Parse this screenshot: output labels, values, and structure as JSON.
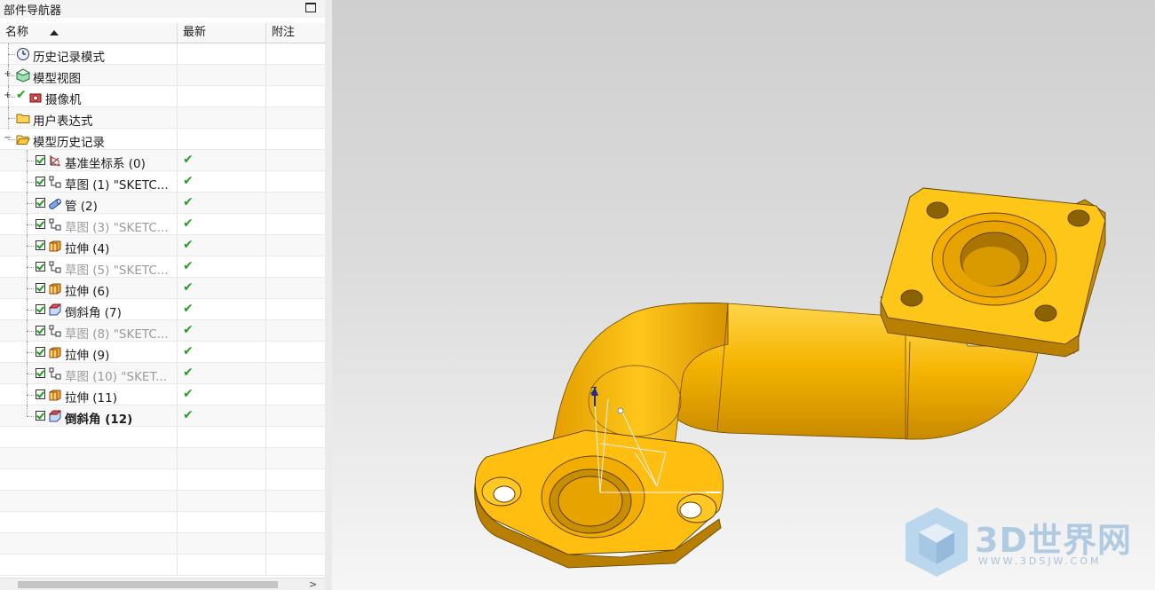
{
  "navigator": {
    "title": "部件导航器",
    "columns": {
      "name": "名称",
      "latest": "最新",
      "notes": "附注"
    },
    "rows": [
      {
        "label": "历史记录模式",
        "icon": "clock-icon",
        "indent": 1,
        "expander": "",
        "checkbox": false,
        "latest": "",
        "style": "normal"
      },
      {
        "label": "模型视图",
        "icon": "model-views-icon",
        "indent": 1,
        "expander": "+",
        "checkbox": false,
        "latest": "",
        "style": "normal"
      },
      {
        "label": "摄像机",
        "icon": "camera-icon",
        "indent": 1,
        "expander": "+",
        "checkbox": false,
        "latest": "",
        "style": "normal"
      },
      {
        "label": "用户表达式",
        "icon": "folder-icon",
        "indent": 1,
        "expander": "",
        "checkbox": false,
        "latest": "",
        "style": "normal"
      },
      {
        "label": "模型历史记录",
        "icon": "folder-open-icon",
        "indent": 1,
        "expander": "−",
        "checkbox": false,
        "latest": "",
        "style": "normal"
      },
      {
        "label": "基准坐标系 (0)",
        "icon": "datum-csys-icon",
        "indent": 2,
        "expander": "",
        "checkbox": true,
        "latest": "✔",
        "style": "normal"
      },
      {
        "label": "草图 (1) \"SKETC...",
        "icon": "sketch-icon",
        "indent": 2,
        "expander": "",
        "checkbox": true,
        "latest": "✔",
        "style": "normal"
      },
      {
        "label": "管 (2)",
        "icon": "tube-icon",
        "indent": 2,
        "expander": "",
        "checkbox": true,
        "latest": "✔",
        "style": "normal"
      },
      {
        "label": "草图 (3) \"SKETC...",
        "icon": "sketch-icon",
        "indent": 2,
        "expander": "",
        "checkbox": true,
        "latest": "✔",
        "style": "gray"
      },
      {
        "label": "拉伸 (4)",
        "icon": "extrude-icon",
        "indent": 2,
        "expander": "",
        "checkbox": true,
        "latest": "✔",
        "style": "normal"
      },
      {
        "label": "草图 (5) \"SKETC...",
        "icon": "sketch-icon",
        "indent": 2,
        "expander": "",
        "checkbox": true,
        "latest": "✔",
        "style": "gray"
      },
      {
        "label": "拉伸 (6)",
        "icon": "extrude-icon",
        "indent": 2,
        "expander": "",
        "checkbox": true,
        "latest": "✔",
        "style": "normal"
      },
      {
        "label": "倒斜角 (7)",
        "icon": "chamfer-icon",
        "indent": 2,
        "expander": "",
        "checkbox": true,
        "latest": "✔",
        "style": "normal"
      },
      {
        "label": "草图 (8) \"SKETC...",
        "icon": "sketch-icon",
        "indent": 2,
        "expander": "",
        "checkbox": true,
        "latest": "✔",
        "style": "gray"
      },
      {
        "label": "拉伸 (9)",
        "icon": "extrude-icon",
        "indent": 2,
        "expander": "",
        "checkbox": true,
        "latest": "✔",
        "style": "normal"
      },
      {
        "label": "草图 (10) \"SKET...",
        "icon": "sketch-icon",
        "indent": 2,
        "expander": "",
        "checkbox": true,
        "latest": "✔",
        "style": "gray"
      },
      {
        "label": "拉伸 (11)",
        "icon": "extrude-icon",
        "indent": 2,
        "expander": "",
        "checkbox": true,
        "latest": "✔",
        "style": "normal"
      },
      {
        "label": "倒斜角 (12)",
        "icon": "chamfer-icon",
        "indent": 2,
        "expander": "",
        "checkbox": true,
        "latest": "✔",
        "style": "bold"
      }
    ],
    "empty_rows": 7
  },
  "viewport": {
    "axis_label": "Z",
    "model_color": "#f5b400",
    "model_edge_color": "#5a4000"
  },
  "watermark": {
    "text": "3D世界网",
    "url": "WWW.3DSJW.COM"
  }
}
